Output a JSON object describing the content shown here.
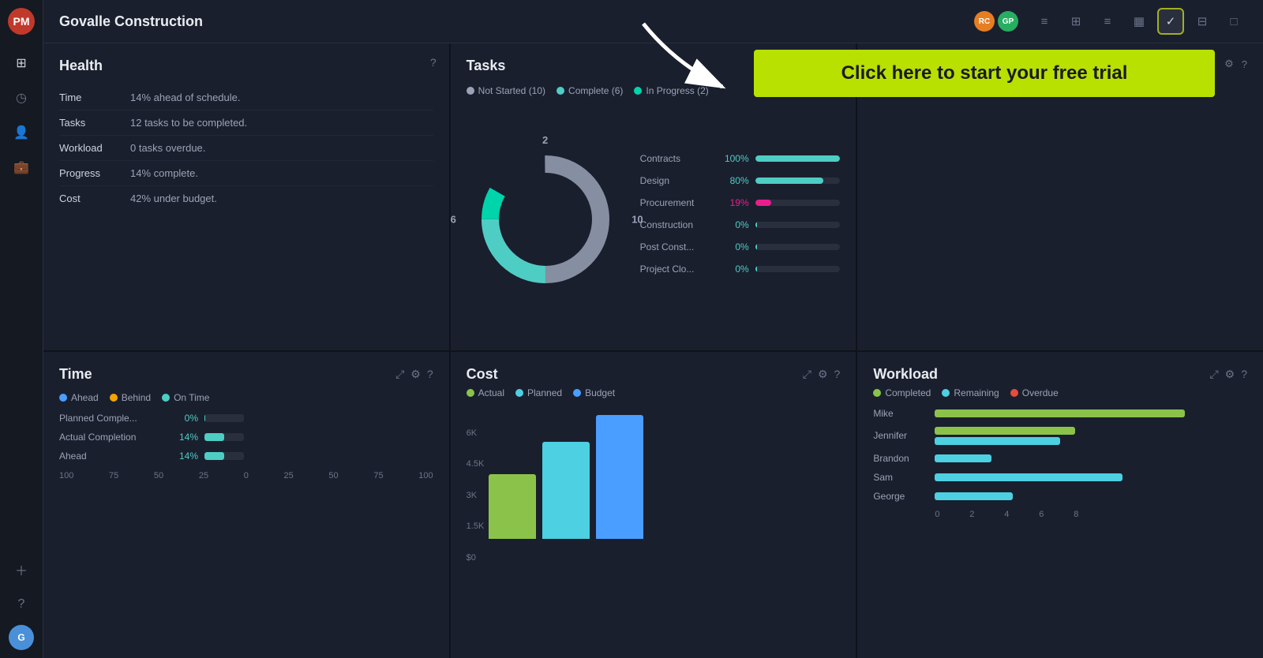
{
  "app": {
    "logo": "PM",
    "title": "Govalle Construction"
  },
  "sidebar": {
    "icons": [
      "⊞",
      "◷",
      "👤",
      "💼"
    ],
    "bottom_icons": [
      "＋",
      "?"
    ]
  },
  "topbar": {
    "title": "Govalle Construction",
    "avatars": [
      {
        "initials": "RC",
        "color": "#e67e22"
      },
      {
        "initials": "GP",
        "color": "#27ae60"
      }
    ],
    "tools": [
      {
        "icon": "≡",
        "label": "list-view",
        "active": false
      },
      {
        "icon": "⊞",
        "label": "board-view",
        "active": false
      },
      {
        "icon": "≡",
        "label": "gantt-view",
        "active": false
      },
      {
        "icon": "▦",
        "label": "table-view",
        "active": false
      },
      {
        "icon": "√",
        "label": "dashboard-view",
        "active": true
      },
      {
        "icon": "⊟",
        "label": "calendar-view",
        "active": false
      },
      {
        "icon": "□",
        "label": "doc-view",
        "active": false
      }
    ]
  },
  "health": {
    "title": "Health",
    "rows": [
      {
        "label": "Time",
        "value": "14% ahead of schedule."
      },
      {
        "label": "Tasks",
        "value": "12 tasks to be completed."
      },
      {
        "label": "Workload",
        "value": "0 tasks overdue."
      },
      {
        "label": "Progress",
        "value": "14% complete."
      },
      {
        "label": "Cost",
        "value": "42% under budget."
      }
    ]
  },
  "tasks": {
    "title": "Tasks",
    "legend": [
      {
        "label": "Not Started (10)",
        "color": "#9aa3b5"
      },
      {
        "label": "Complete (6)",
        "color": "#4ecdc4"
      },
      {
        "label": "In Progress (2)",
        "color": "#00d4aa"
      }
    ],
    "donut": {
      "not_started": 10,
      "complete": 6,
      "in_progress": 2,
      "label_left": "6",
      "label_right": "10",
      "label_top": "2"
    },
    "bars": [
      {
        "label": "Contracts",
        "pct": 100,
        "pct_label": "100%",
        "color": "#4ecdc4"
      },
      {
        "label": "Design",
        "pct": 80,
        "pct_label": "80%",
        "color": "#4ecdc4"
      },
      {
        "label": "Procurement",
        "pct": 19,
        "pct_label": "19%",
        "color": "#e91e8c"
      },
      {
        "label": "Construction",
        "pct": 0,
        "pct_label": "0%",
        "color": "#4ecdc4"
      },
      {
        "label": "Post Const...",
        "pct": 0,
        "pct_label": "0%",
        "color": "#4ecdc4"
      },
      {
        "label": "Project Clo...",
        "pct": 0,
        "pct_label": "0%",
        "color": "#4ecdc4"
      }
    ]
  },
  "time": {
    "title": "Time",
    "legend": [
      {
        "label": "Ahead",
        "color": "#4a9eff"
      },
      {
        "label": "Behind",
        "color": "#f0a500"
      },
      {
        "label": "On Time",
        "color": "#4ecdc4"
      }
    ],
    "rows": [
      {
        "label": "Planned Comple...",
        "pct_label": "0%",
        "pct": 0
      },
      {
        "label": "Actual Completion",
        "pct_label": "14%",
        "pct": 14
      },
      {
        "label": "Ahead",
        "pct_label": "14%",
        "pct": 14
      }
    ],
    "axis": [
      "100",
      "75",
      "50",
      "25",
      "0",
      "25",
      "50",
      "75",
      "100"
    ]
  },
  "cost": {
    "title": "Cost",
    "legend": [
      {
        "label": "Actual",
        "color": "#8bc34a"
      },
      {
        "label": "Planned",
        "color": "#4dd0e1"
      },
      {
        "label": "Budget",
        "color": "#4a9eff"
      }
    ],
    "y_labels": [
      "6K",
      "4.5K",
      "3K",
      "1.5K",
      "$0"
    ],
    "bars": [
      {
        "label": "Actual",
        "height_pct": 48,
        "color": "#8bc34a"
      },
      {
        "label": "Planned",
        "height_pct": 75,
        "color": "#4dd0e1"
      },
      {
        "label": "Budget",
        "height_pct": 95,
        "color": "#4a9eff"
      }
    ]
  },
  "workload": {
    "title": "Workload",
    "legend": [
      {
        "label": "Completed",
        "color": "#8bc34a"
      },
      {
        "label": "Remaining",
        "color": "#4dd0e1"
      },
      {
        "label": "Overdue",
        "color": "#e74c3c"
      }
    ],
    "people": [
      {
        "name": "Mike",
        "completed": 80,
        "remaining": 0,
        "overdue": 0
      },
      {
        "name": "Jennifer",
        "completed": 45,
        "remaining": 40,
        "overdue": 0
      },
      {
        "name": "Brandon",
        "completed": 0,
        "remaining": 20,
        "overdue": 0
      },
      {
        "name": "Sam",
        "completed": 0,
        "remaining": 60,
        "overdue": 0
      },
      {
        "name": "George",
        "completed": 0,
        "remaining": 25,
        "overdue": 0
      }
    ],
    "axis": [
      "0",
      "2",
      "4",
      "6",
      "8"
    ]
  },
  "free_trial": {
    "text": "Click here to start your free trial"
  }
}
